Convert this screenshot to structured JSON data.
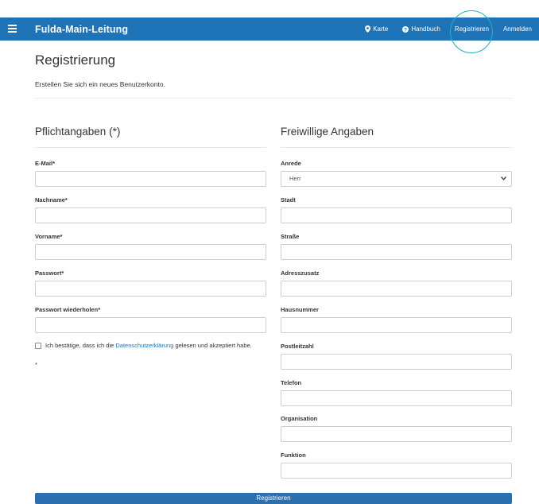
{
  "navbar": {
    "brand": "Fulda-Main-Leitung",
    "links": [
      {
        "label": "Karte",
        "icon": "map-marker-icon"
      },
      {
        "label": "Handbuch",
        "icon": "question-circle-icon"
      },
      {
        "label": "Registrieren",
        "icon": ""
      },
      {
        "label": "Anmelden",
        "icon": ""
      }
    ],
    "highlighted_link": "Registrieren"
  },
  "page": {
    "title": "Registrierung",
    "subtitle": "Erstellen Sie sich ein neues Benutzerkonto."
  },
  "required": {
    "heading": "Pflichtangaben (*)",
    "fields": [
      {
        "label": "E-Mail*",
        "value": ""
      },
      {
        "label": "Nachname*",
        "value": ""
      },
      {
        "label": "Vorname*",
        "value": ""
      },
      {
        "label": "Passwort*",
        "value": ""
      },
      {
        "label": "Passwort wiederholen*",
        "value": ""
      }
    ],
    "consent": {
      "prefix": "Ich bestätige, dass ich die ",
      "link": "Datenschutzerklärung",
      "suffix": " gelesen und akzeptiert habe.",
      "checked": false
    },
    "asterisk_note": "*"
  },
  "optional": {
    "heading": "Freiwillige Angaben",
    "anrede_label": "Anrede",
    "anrede_value": "Herr",
    "fields": [
      {
        "label": "Stadt",
        "value": ""
      },
      {
        "label": "Straße",
        "value": ""
      },
      {
        "label": "Adresszusatz",
        "value": ""
      },
      {
        "label": "Hausnummer",
        "value": ""
      },
      {
        "label": "Postleitzahl",
        "value": ""
      },
      {
        "label": "Telefon",
        "value": ""
      },
      {
        "label": "Organisation",
        "value": ""
      },
      {
        "label": "Funktion",
        "value": ""
      }
    ]
  },
  "submit_label": "Registrieren",
  "colors": {
    "navbar": "#1f73b7",
    "link": "#1f73b7",
    "highlight_ring": "#1fb2c6",
    "submit": "#2a6fb0"
  }
}
